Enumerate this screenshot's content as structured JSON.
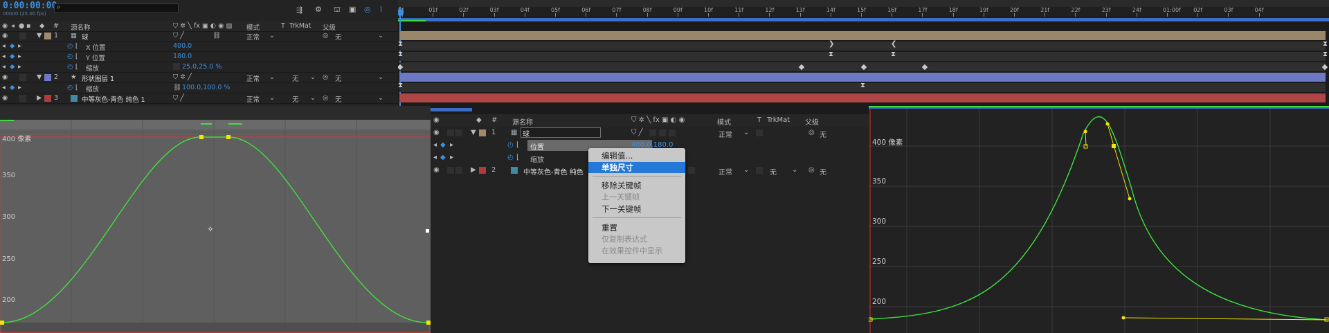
{
  "timeline": {
    "timecode": "0:00:00:00",
    "fps": "00000 (25.00 fps)",
    "search_placeholder": "",
    "columns": {
      "source": "源名称",
      "mode": "模式",
      "t": "T",
      "trkmat": "TrkMat",
      "parent": "父级"
    },
    "ruler": [
      "0f",
      "01f",
      "02f",
      "03f",
      "04f",
      "05f",
      "06f",
      "07f",
      "08f",
      "09f",
      "10f",
      "11f",
      "12f",
      "13f",
      "14f",
      "15f",
      "16f",
      "17f",
      "18f",
      "19f",
      "20f",
      "21f",
      "22f",
      "23f",
      "24f",
      "01:00f",
      "02f",
      "03f",
      "04f"
    ],
    "layers": [
      {
        "num": "1",
        "name": "球",
        "mode": "正常",
        "parent": "无",
        "color": "#a08a6a"
      },
      {
        "prop": "X 位置",
        "value": "400.0"
      },
      {
        "prop": "Y 位置",
        "value": "180.0"
      },
      {
        "prop": "缩放",
        "value": "25.0,25.0 %"
      },
      {
        "num": "2",
        "name": "形状图层 1",
        "mode": "正常",
        "trkmat": "无",
        "parent": "无",
        "color": "#6d79c4"
      },
      {
        "prop": "缩放",
        "value": "100.0,100.0 %"
      },
      {
        "num": "3",
        "name": "中等灰色-青色 纯色 1",
        "mode": "正常",
        "trkmat": "无",
        "parent": "无",
        "color": "#b13a3a"
      }
    ]
  },
  "graph_left": {
    "y_labels": [
      "400 像素",
      "350",
      "300",
      "250",
      "200"
    ]
  },
  "middle": {
    "header": {
      "source": "源名称",
      "mode": "模式",
      "t": "T",
      "trkmat": "TrkMat",
      "parent": "父级"
    },
    "layer1": {
      "num": "1",
      "name": "球",
      "mode": "正常",
      "parent": "无"
    },
    "prop_pos": {
      "name": "位置",
      "value": "400.0,180.0"
    },
    "prop_scale": {
      "name": "缩放"
    },
    "layer2": {
      "num": "2",
      "name": "中等灰色-青色 纯色",
      "mode": "正常",
      "trkmat": "无",
      "parent": "无"
    }
  },
  "context_menu": {
    "items": [
      {
        "label": "编辑值...",
        "state": "normal"
      },
      {
        "label": "单独尺寸",
        "state": "selected"
      },
      {
        "label": "移除关键帧",
        "state": "normal"
      },
      {
        "label": "上一关键帧",
        "state": "disabled"
      },
      {
        "label": "下一关键帧",
        "state": "normal"
      },
      {
        "label": "重置",
        "state": "normal"
      },
      {
        "label": "仅复制表达式",
        "state": "disabled"
      },
      {
        "label": "在效果控件中显示",
        "state": "disabled"
      }
    ]
  },
  "graph_right": {
    "y_labels": [
      "400 像素",
      "350",
      "300",
      "250",
      "200"
    ]
  },
  "colors": {
    "accent": "#2d8ceb",
    "curve": "#3fe03f",
    "keyframe": "#f3e600",
    "bounds": "#e03030"
  }
}
